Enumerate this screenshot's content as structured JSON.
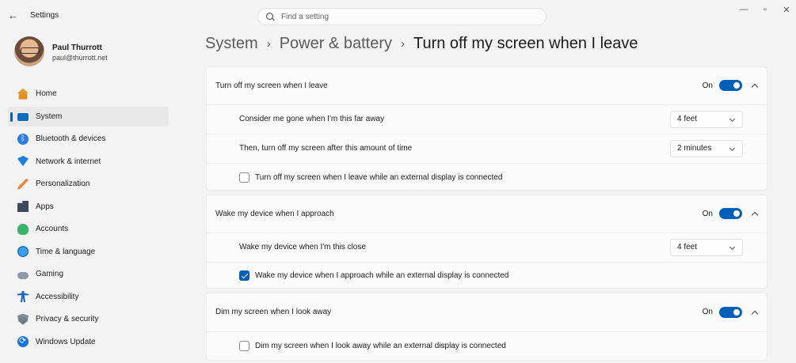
{
  "window": {
    "title": "Settings",
    "back_icon": "←",
    "minimize": "—",
    "restore": "▫",
    "close": "✕"
  },
  "search": {
    "placeholder": "Find a setting",
    "value": ""
  },
  "profile": {
    "name": "Paul Thurrott",
    "email": "paul@thurrott.net"
  },
  "sidebar": {
    "items": [
      {
        "label": "Home",
        "icon": "home-icon",
        "active": false
      },
      {
        "label": "System",
        "icon": "system-icon",
        "active": true
      },
      {
        "label": "Bluetooth & devices",
        "icon": "bluetooth-icon",
        "active": false
      },
      {
        "label": "Network & internet",
        "icon": "network-icon",
        "active": false
      },
      {
        "label": "Personalization",
        "icon": "personalization-icon",
        "active": false
      },
      {
        "label": "Apps",
        "icon": "apps-icon",
        "active": false
      },
      {
        "label": "Accounts",
        "icon": "accounts-icon",
        "active": false
      },
      {
        "label": "Time & language",
        "icon": "time-language-icon",
        "active": false
      },
      {
        "label": "Gaming",
        "icon": "gaming-icon",
        "active": false
      },
      {
        "label": "Accessibility",
        "icon": "accessibility-icon",
        "active": false
      },
      {
        "label": "Privacy & security",
        "icon": "privacy-shield-icon",
        "active": false
      },
      {
        "label": "Windows Update",
        "icon": "windows-update-icon",
        "active": false
      }
    ]
  },
  "breadcrumb": {
    "items": [
      "System",
      "Power & battery"
    ],
    "separator": "›",
    "current": "Turn off my screen when I leave"
  },
  "sections": {
    "turn_off": {
      "title": "Turn off my screen when I leave",
      "toggle_label": "On",
      "toggle_on": true,
      "gone_label": "Consider me gone when I'm this far away",
      "gone_value": "4 feet",
      "after_label": "Then, turn off my screen after this amount of time",
      "after_value": "2 minutes",
      "external_label": "Turn off my screen when I leave while an external display is connected",
      "external_checked": false
    },
    "wake": {
      "title": "Wake my device when I approach",
      "toggle_label": "On",
      "toggle_on": true,
      "close_label": "Wake my device when I'm this close",
      "close_value": "4 feet",
      "external_label": "Wake my device when I approach while an external display is connected",
      "external_checked": true
    },
    "dim": {
      "title": "Dim my screen when I look away",
      "toggle_label": "On",
      "toggle_on": true,
      "external_label": "Dim my screen when I look away while an external display is connected",
      "external_checked": false
    }
  },
  "colors": {
    "accent": "#005fb8",
    "background": "#f3f3f3",
    "card": "#fbfbfb"
  }
}
